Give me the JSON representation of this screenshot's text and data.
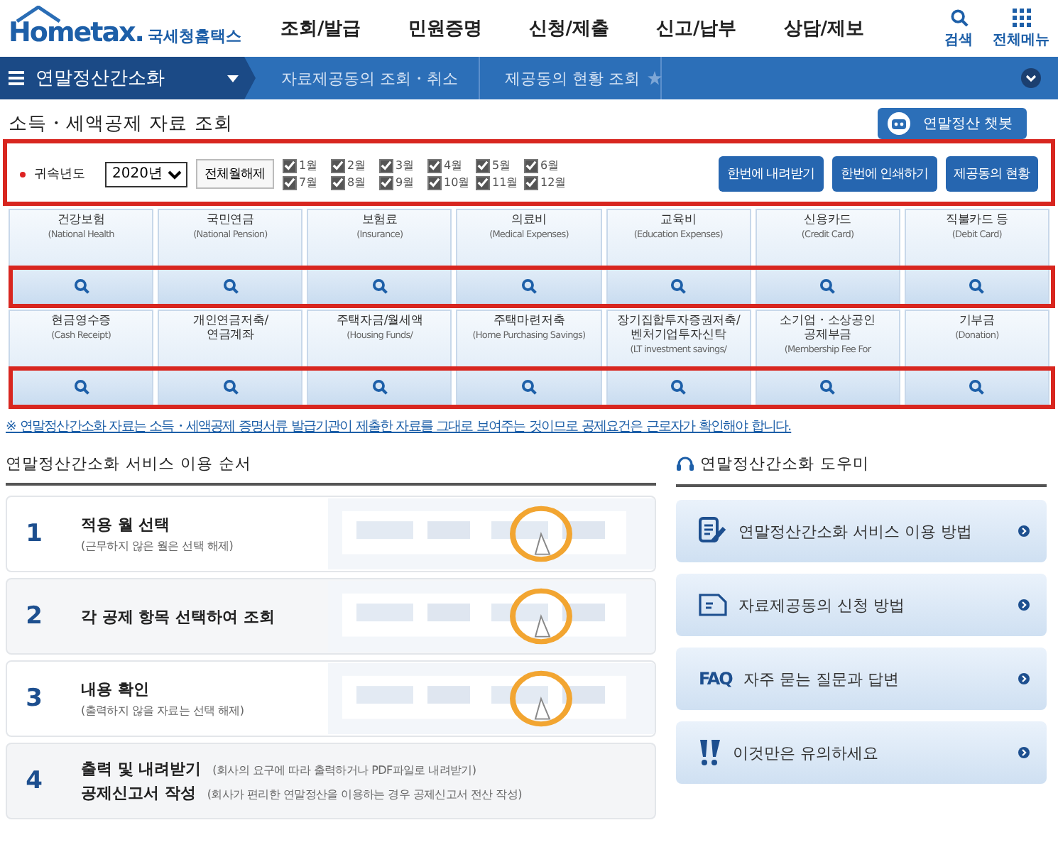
{
  "header": {
    "logo": "Hometax.",
    "logo_sub": "국세청홈택스",
    "menu": [
      "조회/발급",
      "민원증명",
      "신청/제출",
      "신고/납부",
      "상담/제보"
    ],
    "search_label": "검색",
    "all_menu_label": "전체메뉴"
  },
  "nav": {
    "section": "연말정산간소화",
    "crumbs": [
      "자료제공동의 조회・취소",
      "제공동의 현황 조회"
    ]
  },
  "page_title": "소득・세액공제 자료 조회",
  "chatbot_button": "연말정산 챗봇",
  "filter": {
    "label": "귀속년도",
    "year": "2020년",
    "clear_button": "전체월해제",
    "months": [
      {
        "label": "1월",
        "checked": true
      },
      {
        "label": "2월",
        "checked": true
      },
      {
        "label": "3월",
        "checked": true
      },
      {
        "label": "4월",
        "checked": true
      },
      {
        "label": "5월",
        "checked": true
      },
      {
        "label": "6월",
        "checked": true
      },
      {
        "label": "7월",
        "checked": true
      },
      {
        "label": "8월",
        "checked": true
      },
      {
        "label": "9월",
        "checked": true
      },
      {
        "label": "10월",
        "checked": true
      },
      {
        "label": "11월",
        "checked": true
      },
      {
        "label": "12월",
        "checked": true
      }
    ],
    "buttons": [
      "한번에 내려받기",
      "한번에 인쇄하기",
      "제공동의 현황"
    ]
  },
  "categories": [
    {
      "title": "건강보험",
      "subtitle": "(National Health"
    },
    {
      "title": "국민연금",
      "subtitle": "(National Pension)"
    },
    {
      "title": "보험료",
      "subtitle": "(Insurance)"
    },
    {
      "title": "의료비",
      "subtitle": "(Medical Expenses)"
    },
    {
      "title": "교육비",
      "subtitle": "(Education Expenses)"
    },
    {
      "title": "신용카드",
      "subtitle": "(Credit Card)"
    },
    {
      "title": "직불카드 등",
      "subtitle": "(Debit Card)"
    },
    {
      "title": "현금영수증",
      "subtitle": "(Cash Receipt)"
    },
    {
      "title": "개인연금저축/\n연금계좌"
    },
    {
      "title": "주택자금/월세액",
      "subtitle": "(Housing Funds/"
    },
    {
      "title": "주택마련저축",
      "subtitle": "(Home Purchasing Savings)"
    },
    {
      "title": "장기집합투자증권저축/\n벤처기업투자신탁",
      "subtitle": "(LT investment savings/"
    },
    {
      "title": "소기업・소상공인\n공제부금",
      "subtitle": "(Membership Fee For"
    },
    {
      "title": "기부금",
      "subtitle": "(Donation)"
    }
  ],
  "notice": "※ 연말정산간소화 자료는 소득・세액공제 증명서류 발급기관이 제출한 자료를 그대로 보여주는 것이므로 공제요건은 근로자가 확인해야 합니다.",
  "guide": {
    "title": "연말정산간소화 서비스 이용 순서",
    "steps": [
      {
        "number": "1",
        "kind": "stacked",
        "lines": [
          {
            "title": "적용 월 선택",
            "note": "(근무하지 않은 월은 선택 해제)"
          }
        ],
        "picture": {
          "kind": "picture"
        }
      },
      {
        "number": "2",
        "kind": "stacked",
        "lines": [
          {
            "title": "각 공제 항목 선택하여 조회"
          }
        ],
        "picture": {
          "kind": "picture"
        }
      },
      {
        "number": "3",
        "kind": "stacked",
        "lines": [
          {
            "title": "내용 확인",
            "note": "(출력하지 않을 자료는 선택 해제)"
          }
        ],
        "picture": {
          "kind": "picture"
        }
      },
      {
        "number": "4",
        "kind": "inline",
        "lines": [
          {
            "title": "출력 및 내려받기",
            "note": "(회사의 요구에 따라 출력하거나 PDF파일로 내려받기)"
          },
          {
            "title": "공제신고서 작성",
            "note": "(회사가 편리한 연말정산을 이용하는 경우 공제신고서 전산 작성)"
          }
        ]
      }
    ]
  },
  "helper": {
    "title": "연말정산간소화 도우미",
    "items": [
      {
        "kind": "doc-pen",
        "label": "연말정산간소화 서비스 이용 방법"
      },
      {
        "kind": "doc",
        "label": "자료제공동의 신청 방법"
      },
      {
        "kind": "faq",
        "badge": "FAQ",
        "label": "자주 묻는 질문과 답변"
      },
      {
        "kind": "alert",
        "label": "이것만은 유의하세요"
      }
    ]
  }
}
